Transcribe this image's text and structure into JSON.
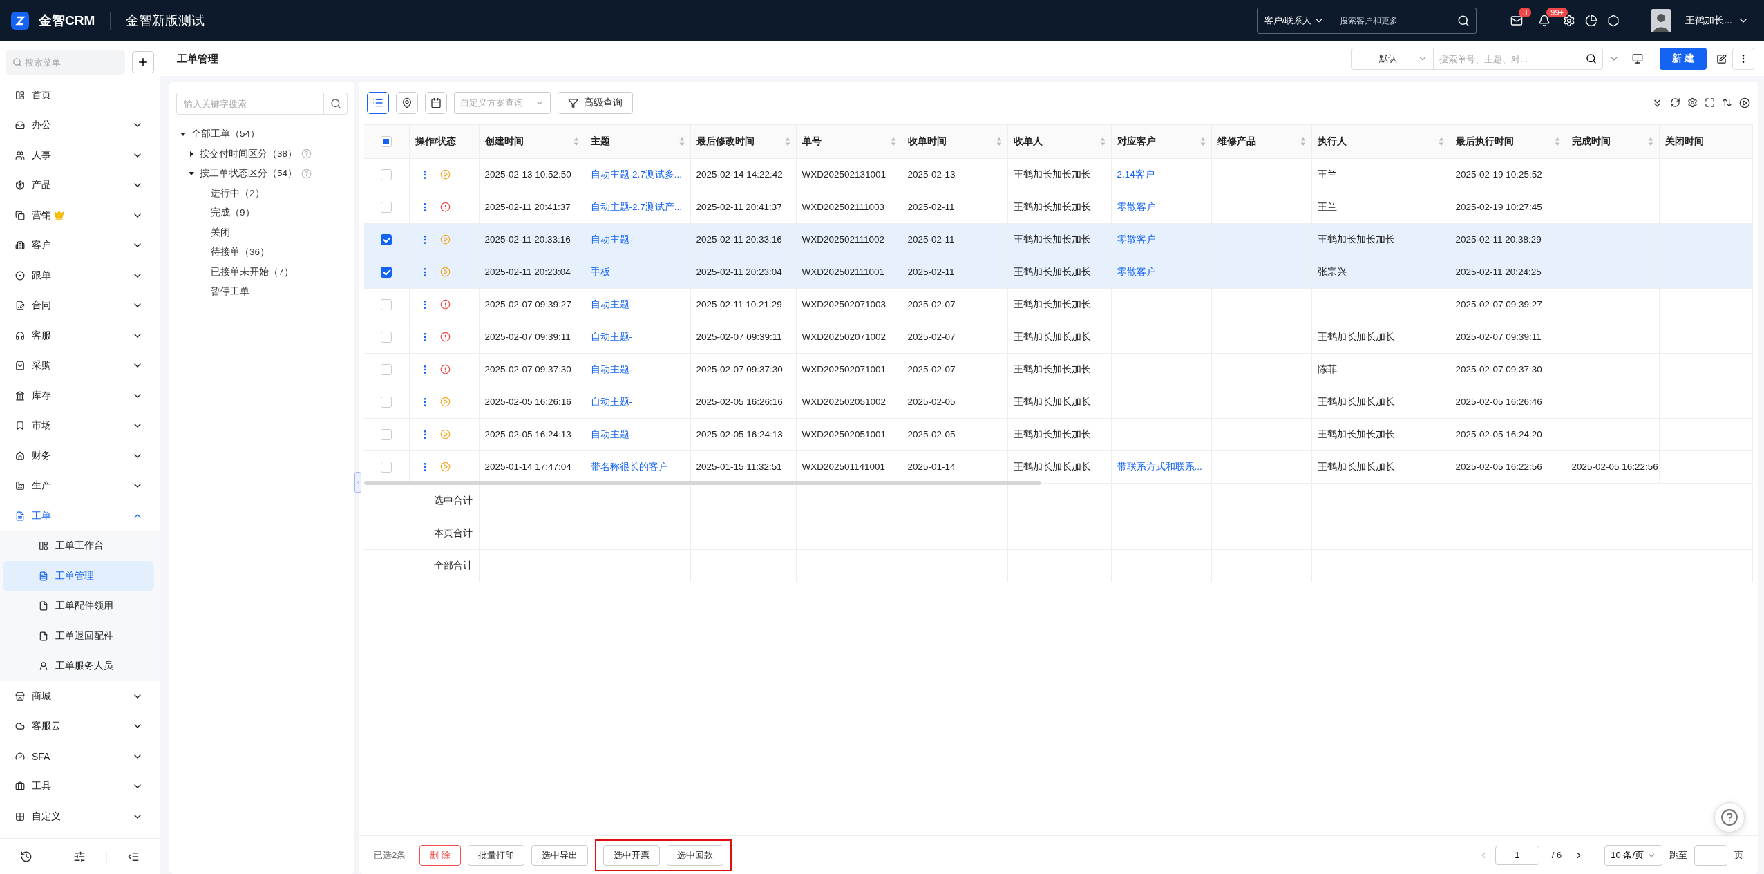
{
  "topbar": {
    "brand": "金智CRM",
    "workspace": "金智新版测试",
    "search_scope": "客户/联系人",
    "search_placeholder": "搜索客户和更多",
    "mail_badge": "3",
    "bell_badge": "99+",
    "user": "王鹤加长..."
  },
  "sidebar": {
    "search_placeholder": "搜索菜单",
    "items": [
      {
        "label": "首页",
        "kind": "link",
        "selected": false
      },
      {
        "label": "办公",
        "kind": "group",
        "expanded": false,
        "selected": false
      },
      {
        "label": "人事",
        "kind": "group",
        "expanded": false,
        "selected": false
      },
      {
        "label": "产品",
        "kind": "group",
        "expanded": false,
        "selected": false
      },
      {
        "label": "营销",
        "kind": "group",
        "expanded": false,
        "selected": false,
        "crown": true
      },
      {
        "label": "客户",
        "kind": "group",
        "expanded": false,
        "selected": false
      },
      {
        "label": "跟单",
        "kind": "group",
        "expanded": false,
        "selected": false
      },
      {
        "label": "合同",
        "kind": "group",
        "expanded": false,
        "selected": false
      },
      {
        "label": "客服",
        "kind": "group",
        "expanded": false,
        "selected": false
      },
      {
        "label": "采购",
        "kind": "group",
        "expanded": false,
        "selected": false
      },
      {
        "label": "库存",
        "kind": "group",
        "expanded": false,
        "selected": false
      },
      {
        "label": "市场",
        "kind": "group",
        "expanded": false,
        "selected": false
      },
      {
        "label": "财务",
        "kind": "group",
        "expanded": false,
        "selected": false
      },
      {
        "label": "生产",
        "kind": "group",
        "expanded": false,
        "selected": false
      },
      {
        "label": "工单",
        "kind": "group",
        "expanded": true,
        "selected": true,
        "children": [
          {
            "label": "工单工作台",
            "selected": false
          },
          {
            "label": "工单管理",
            "selected": true
          },
          {
            "label": "工单配件领用",
            "selected": false
          },
          {
            "label": "工单退回配件",
            "selected": false
          },
          {
            "label": "工单服务人员",
            "selected": false
          }
        ]
      },
      {
        "label": "商城",
        "kind": "group",
        "expanded": false,
        "selected": false
      },
      {
        "label": "客服云",
        "kind": "group",
        "expanded": false,
        "selected": false
      },
      {
        "label": "SFA",
        "kind": "group",
        "expanded": false,
        "selected": false
      },
      {
        "label": "工具",
        "kind": "group",
        "expanded": false,
        "selected": false
      },
      {
        "label": "自定义",
        "kind": "group",
        "expanded": false,
        "selected": false
      }
    ]
  },
  "page": {
    "title": "工单管理",
    "view_select": "默认",
    "search_placeholder": "搜索单号、主题、对...",
    "new_button": "新 建"
  },
  "tree": {
    "search_placeholder": "输入关键字搜索",
    "nodes": [
      {
        "label": "全部工单（54）",
        "kind": "branch",
        "expanded": true,
        "children": [
          {
            "label": "按交付时间区分（38）",
            "kind": "branch",
            "expanded": false,
            "help": true
          },
          {
            "label": "按工单状态区分（54）",
            "kind": "branch",
            "expanded": true,
            "help": true,
            "children": [
              {
                "label": "进行中（2）",
                "kind": "leaf"
              },
              {
                "label": "完成（9）",
                "kind": "leaf"
              },
              {
                "label": "关闭",
                "kind": "leaf"
              },
              {
                "label": "待接单（36）",
                "kind": "leaf"
              },
              {
                "label": "已接单未开始（7）",
                "kind": "leaf"
              },
              {
                "label": "暂停工单",
                "kind": "leaf"
              }
            ]
          }
        ]
      }
    ]
  },
  "toolbar": {
    "views": [
      {
        "kind": "list",
        "selected": true
      },
      {
        "kind": "map",
        "selected": false
      },
      {
        "kind": "calendar",
        "selected": false
      }
    ],
    "scheme_placeholder": "自定义方案查询",
    "advanced": "高级查询"
  },
  "table": {
    "all_selected": false,
    "some_selected": true,
    "op_header": "操作/状态",
    "columns": [
      {
        "label": "创建时间",
        "sortable": true
      },
      {
        "label": "主题",
        "sortable": true
      },
      {
        "label": "最后修改时间",
        "sortable": true
      },
      {
        "label": "单号",
        "sortable": true
      },
      {
        "label": "收单时间",
        "sortable": true
      },
      {
        "label": "收单人",
        "sortable": true
      },
      {
        "label": "对应客户",
        "sortable": true
      },
      {
        "label": "维修产品",
        "sortable": true
      },
      {
        "label": "执行人",
        "sortable": true
      },
      {
        "label": "最后执行时间",
        "sortable": true
      },
      {
        "label": "完成时间",
        "sortable": true
      },
      {
        "label": "关闭时间",
        "sortable": false
      }
    ],
    "rows": [
      {
        "selected": false,
        "kind": "running",
        "cells": [
          "2025-02-13 10:52:50",
          "自动主题-2.7测试多...",
          "2025-02-14 14:22:42",
          "WXD202502131001",
          "2025-02-13",
          "王鹤加长加长加长",
          "2.14客户",
          "",
          "王兰",
          "2025-02-19 10:25:52",
          "",
          ""
        ]
      },
      {
        "selected": false,
        "kind": "alert",
        "cells": [
          "2025-02-11 20:41:37",
          "自动主题-2.7测试产...",
          "2025-02-11 20:41:37",
          "WXD202502111003",
          "2025-02-11",
          "王鹤加长加长加长",
          "零散客户",
          "",
          "王兰",
          "2025-02-19 10:27:45",
          "",
          ""
        ]
      },
      {
        "selected": true,
        "kind": "running",
        "cells": [
          "2025-02-11 20:33:16",
          "自动主题-",
          "2025-02-11 20:33:16",
          "WXD202502111002",
          "2025-02-11",
          "王鹤加长加长加长",
          "零散客户",
          "",
          "王鹤加长加长加长",
          "2025-02-11 20:38:29",
          "",
          ""
        ]
      },
      {
        "selected": true,
        "kind": "running",
        "cells": [
          "2025-02-11 20:23:04",
          "手板",
          "2025-02-11 20:23:04",
          "WXD202502111001",
          "2025-02-11",
          "王鹤加长加长加长",
          "零散客户",
          "",
          "张宗兴",
          "2025-02-11 20:24:25",
          "",
          ""
        ]
      },
      {
        "selected": false,
        "kind": "alert",
        "cells": [
          "2025-02-07 09:39:27",
          "自动主题-",
          "2025-02-11 10:21:29",
          "WXD202502071003",
          "2025-02-07",
          "王鹤加长加长加长",
          "",
          "",
          "",
          "2025-02-07 09:39:27",
          "",
          ""
        ]
      },
      {
        "selected": false,
        "kind": "alert",
        "cells": [
          "2025-02-07 09:39:11",
          "自动主题-",
          "2025-02-07 09:39:11",
          "WXD202502071002",
          "2025-02-07",
          "王鹤加长加长加长",
          "",
          "",
          "王鹤加长加长加长",
          "2025-02-07 09:39:11",
          "",
          ""
        ]
      },
      {
        "selected": false,
        "kind": "alert",
        "cells": [
          "2025-02-07 09:37:30",
          "自动主题-",
          "2025-02-07 09:37:30",
          "WXD202502071001",
          "2025-02-07",
          "王鹤加长加长加长",
          "",
          "",
          "陈菲",
          "2025-02-07 09:37:30",
          "",
          ""
        ]
      },
      {
        "selected": false,
        "kind": "running",
        "cells": [
          "2025-02-05 16:26:16",
          "自动主题-",
          "2025-02-05 16:26:16",
          "WXD202502051002",
          "2025-02-05",
          "王鹤加长加长加长",
          "",
          "",
          "王鹤加长加长加长",
          "2025-02-05 16:26:46",
          "",
          ""
        ]
      },
      {
        "selected": false,
        "kind": "running",
        "cells": [
          "2025-02-05 16:24:13",
          "自动主题-",
          "2025-02-05 16:24:13",
          "WXD202502051001",
          "2025-02-05",
          "王鹤加长加长加长",
          "",
          "",
          "王鹤加长加长加长",
          "2025-02-05 16:24:20",
          "",
          ""
        ]
      },
      {
        "selected": false,
        "kind": "running",
        "cells": [
          "2025-01-14 17:47:04",
          "带名称很长的客户",
          "2025-01-15 11:32:51",
          "WXD202501141001",
          "2025-01-14",
          "王鹤加长加长加长",
          "带联系方式和联系...",
          "",
          "王鹤加长加长加长",
          "2025-02-05 16:22:56",
          "2025-02-05 16:22:56",
          ""
        ]
      }
    ],
    "summaries": [
      "选中合计",
      "本页合计",
      "全部合计"
    ]
  },
  "footer": {
    "selected_count": "已选2条",
    "actions": [
      {
        "label": "删 除",
        "kind": "danger"
      },
      {
        "label": "批量打印",
        "kind": "normal"
      },
      {
        "label": "选中导出",
        "kind": "normal"
      }
    ],
    "boxed_actions": [
      {
        "label": "选中开票",
        "kind": "normal"
      },
      {
        "label": "选中回款",
        "kind": "normal"
      }
    ],
    "page": "1",
    "total_pages": "/ 6",
    "page_size": "10 条/页",
    "jump_label": "跳至",
    "page_unit": "页"
  }
}
